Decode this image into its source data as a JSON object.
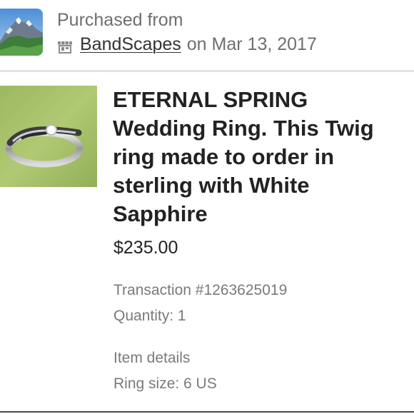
{
  "header": {
    "purchased_label": "Purchased from",
    "shop_icon": "storefront-icon",
    "shop_name": "BandScapes",
    "date_prefix": "on",
    "date": "Mar 13, 2017"
  },
  "item": {
    "title": "ETERNAL SPRING Wedding Ring. This Twig ring made to order in sterling with White Sapphire",
    "price": "$235.00",
    "transaction": "Transaction #1263625019",
    "quantity": "Quantity: 1",
    "details_heading": "Item details",
    "ring_size": "Ring size: 6 US"
  },
  "colors": {
    "muted_text": "#6f6f6f",
    "title_text": "#222222",
    "divider": "#e3e3e3"
  }
}
